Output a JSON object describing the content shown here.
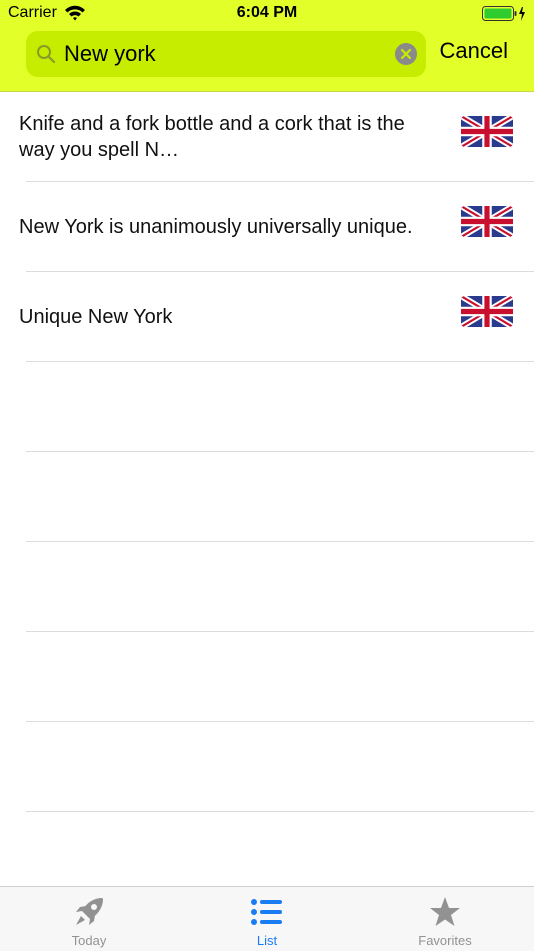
{
  "status_bar": {
    "carrier": "Carrier",
    "time": "6:04 PM"
  },
  "search": {
    "value": "New york",
    "cancel_label": "Cancel"
  },
  "results": [
    {
      "text": "Knife and a fork bottle and a cork that is the way you spell N…",
      "flag": "uk-flag-icon"
    },
    {
      "text": "New York is unanimously universally unique.",
      "flag": "uk-flag-icon"
    },
    {
      "text": "Unique New York",
      "flag": "uk-flag-icon"
    }
  ],
  "tab_bar": {
    "today_label": "Today",
    "list_label": "List",
    "favorites_label": "Favorites"
  },
  "colors": {
    "header_bg": "#e2ff2a",
    "search_bg": "#c6ec00",
    "active_tab": "#1a7cf2",
    "inactive_tab": "#929292",
    "battery": "#2ecc2e"
  }
}
